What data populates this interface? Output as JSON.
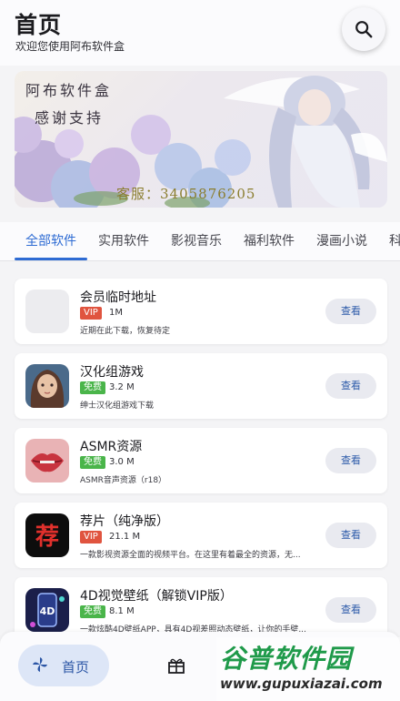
{
  "header": {
    "title": "首页",
    "subtitle": "欢迎您使用阿布软件盒",
    "search_icon": "search-icon"
  },
  "banner": {
    "line1": "阿布软件盒",
    "line2": "感谢支持",
    "line3": "客服：3405876205"
  },
  "tabs": [
    {
      "label": "全部软件",
      "active": true
    },
    {
      "label": "实用软件",
      "active": false
    },
    {
      "label": "影视音乐",
      "active": false
    },
    {
      "label": "福利软件",
      "active": false
    },
    {
      "label": "漫画小说",
      "active": false
    },
    {
      "label": "科",
      "active": false
    }
  ],
  "apps": [
    {
      "name": "会员临时地址",
      "tag": "VIP",
      "size": "1M",
      "desc": "近期在此下载，恢复待定",
      "button": "查看",
      "icon": "blank-icon"
    },
    {
      "name": "汉化组游戏",
      "tag": "免费",
      "size": "3.2 M",
      "desc": "绅士汉化组游戏下载",
      "button": "查看",
      "icon": "anime-girl-icon"
    },
    {
      "name": "ASMR资源",
      "tag": "免费",
      "size": "3.0 M",
      "desc": "ASMR音声资源（r18）",
      "button": "查看",
      "icon": "lips-icon"
    },
    {
      "name": "荐片（纯净版）",
      "tag": "VIP",
      "size": "21.1 M",
      "desc": "一款影视资源全面的视频平台。在这里有着最全的资源，无...",
      "button": "查看",
      "icon": "jian-icon"
    },
    {
      "name": "4D视觉壁纸（解锁VIP版）",
      "tag": "免费",
      "size": "8.1 M",
      "desc": "一款炫酷4D壁纸APP，具有4D视差照动态壁纸，让你的手壁...",
      "button": "查看",
      "icon": "4d-icon"
    }
  ],
  "bottom_nav": {
    "home_label": "首页",
    "home_icon": "pinwheel-icon",
    "gift_icon": "gift-icon"
  },
  "watermark": {
    "main": "谷普软件园",
    "url": "www.gupuxiazai.com"
  },
  "colors": {
    "accent": "#2e6bd3",
    "vip": "#e0543f",
    "free": "#4ab54a"
  }
}
